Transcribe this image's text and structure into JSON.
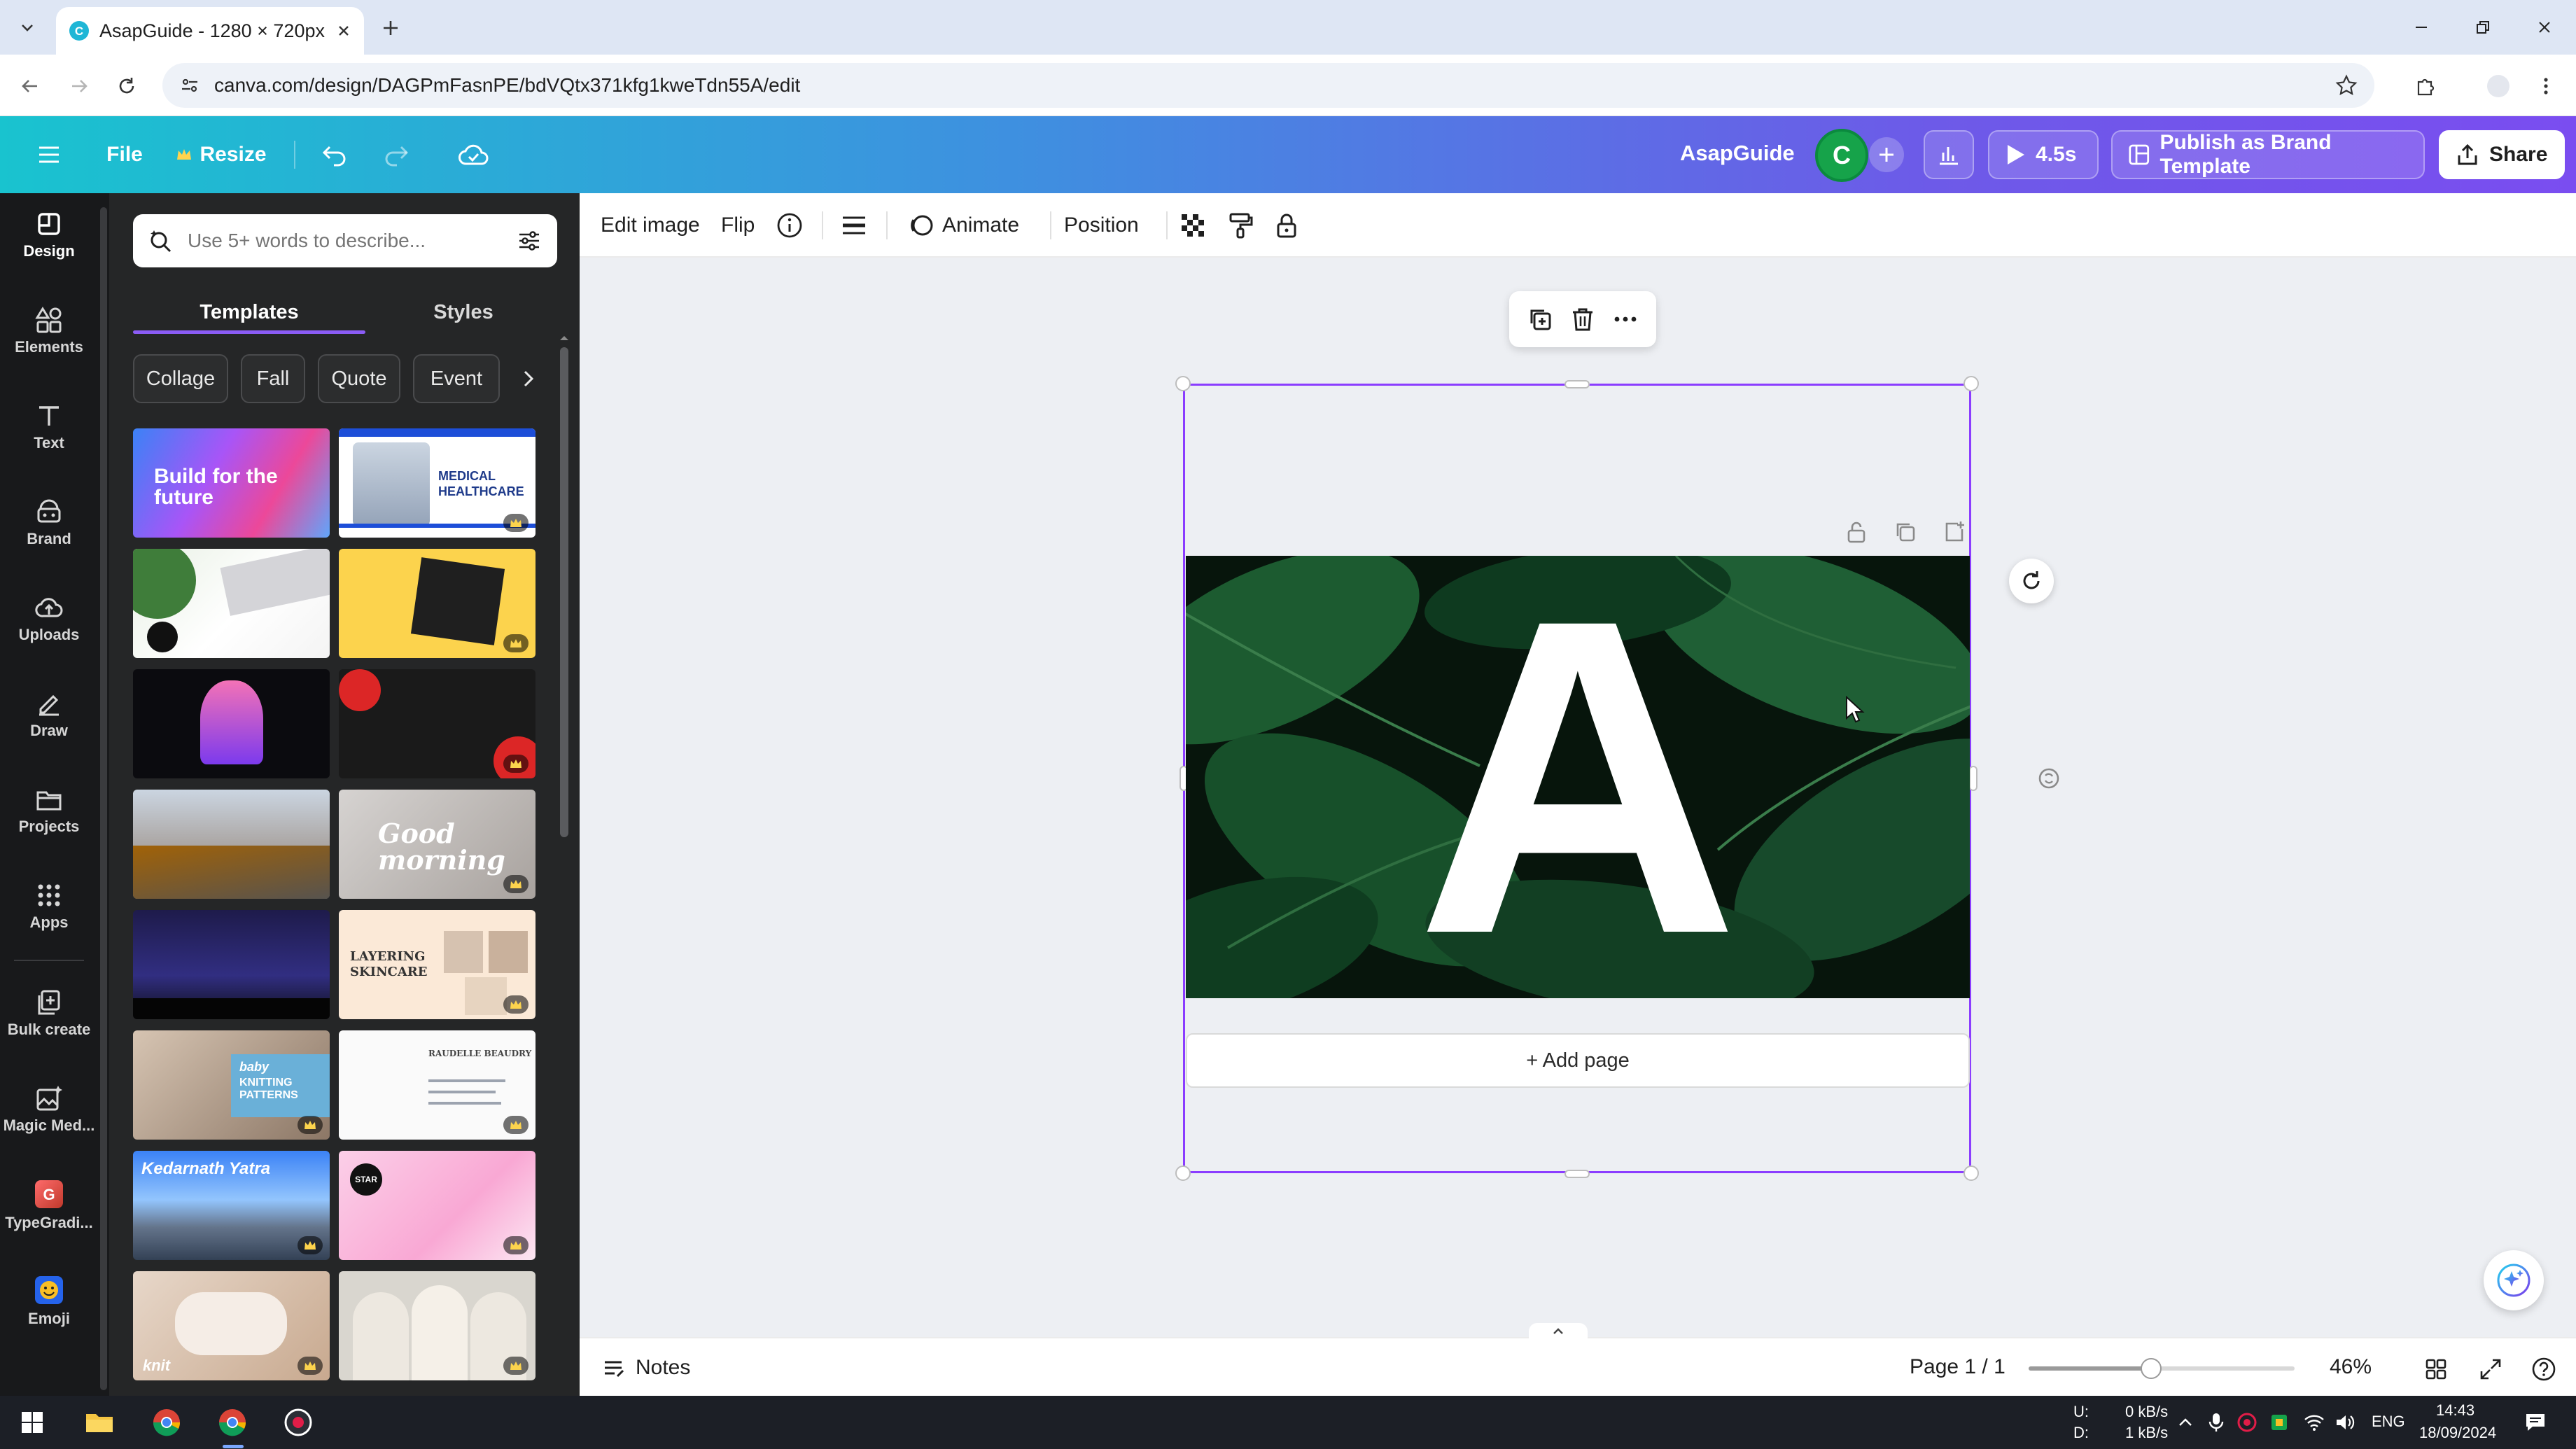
{
  "browser": {
    "tab_title": "AsapGuide - 1280 × 720px",
    "url": "canva.com/design/DAGPmFasnPE/bdVQtx371kfg1kweTdn55A/edit"
  },
  "header": {
    "file_label": "File",
    "resize_label": "Resize",
    "brand_name": "AsapGuide",
    "avatar_letter": "C",
    "present_timer": "4.5s",
    "publish_label": "Publish as Brand Template",
    "share_label": "Share",
    "gradient": [
      "#19c3cf",
      "#7a4df0"
    ]
  },
  "rail": {
    "items": [
      {
        "label": "Design",
        "icon": "design-icon"
      },
      {
        "label": "Elements",
        "icon": "elements-icon"
      },
      {
        "label": "Text",
        "icon": "text-icon"
      },
      {
        "label": "Brand",
        "icon": "brand-icon"
      },
      {
        "label": "Uploads",
        "icon": "uploads-icon"
      },
      {
        "label": "Draw",
        "icon": "draw-icon"
      },
      {
        "label": "Projects",
        "icon": "projects-icon"
      },
      {
        "label": "Apps",
        "icon": "apps-icon"
      },
      {
        "label": "Bulk create",
        "icon": "bulk-create-icon"
      },
      {
        "label": "Magic Med...",
        "icon": "magic-media-icon"
      },
      {
        "label": "TypeGradi...",
        "icon": "typegradient-icon"
      },
      {
        "label": "Emoji",
        "icon": "emoji-icon"
      }
    ]
  },
  "panel": {
    "search_placeholder": "Use 5+ words to describe...",
    "tabs": [
      {
        "label": "Templates"
      },
      {
        "label": "Styles"
      }
    ],
    "chips": [
      {
        "label": "Collage"
      },
      {
        "label": "Fall"
      },
      {
        "label": "Quote"
      },
      {
        "label": "Event"
      }
    ],
    "thumbs": {
      "t1": "Build for the future",
      "t2a": "MEDICAL",
      "t2b": "HEALTHCARE",
      "t9": "Good morning",
      "t12": "LAYERING SKINCARE",
      "t13a": "baby",
      "t13b": "KNITTING PATTERNS",
      "t14": "RAUDELLE BEAUDRY",
      "t15": "Kedarnath Yatra",
      "t16": "STAR",
      "t17": "knit"
    }
  },
  "toolbar": {
    "edit_image": "Edit image",
    "flip": "Flip",
    "animate": "Animate",
    "position": "Position"
  },
  "canvas": {
    "letter": "A",
    "add_page": "+ Add page",
    "selection_color": "#8b3dff"
  },
  "footer": {
    "notes": "Notes",
    "page_indicator": "Page 1 / 1",
    "zoom": "46%",
    "zoom_fraction": 0.46
  },
  "taskbar": {
    "net_up_label": "U:",
    "net_down_label": "D:",
    "net_up": "0 kB/s",
    "net_down": "1 kB/s",
    "lang": "ENG",
    "time": "14:43",
    "date": "18/09/2024"
  }
}
